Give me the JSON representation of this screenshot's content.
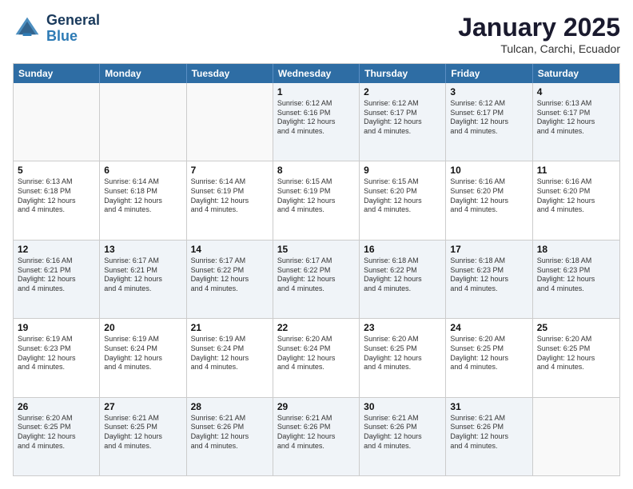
{
  "header": {
    "logo_line1": "General",
    "logo_line2": "Blue",
    "month": "January 2025",
    "location": "Tulcan, Carchi, Ecuador"
  },
  "weekdays": [
    "Sunday",
    "Monday",
    "Tuesday",
    "Wednesday",
    "Thursday",
    "Friday",
    "Saturday"
  ],
  "rows": [
    [
      {
        "day": "",
        "info": ""
      },
      {
        "day": "",
        "info": ""
      },
      {
        "day": "",
        "info": ""
      },
      {
        "day": "1",
        "info": "Sunrise: 6:12 AM\nSunset: 6:16 PM\nDaylight: 12 hours\nand 4 minutes."
      },
      {
        "day": "2",
        "info": "Sunrise: 6:12 AM\nSunset: 6:17 PM\nDaylight: 12 hours\nand 4 minutes."
      },
      {
        "day": "3",
        "info": "Sunrise: 6:12 AM\nSunset: 6:17 PM\nDaylight: 12 hours\nand 4 minutes."
      },
      {
        "day": "4",
        "info": "Sunrise: 6:13 AM\nSunset: 6:17 PM\nDaylight: 12 hours\nand 4 minutes."
      }
    ],
    [
      {
        "day": "5",
        "info": "Sunrise: 6:13 AM\nSunset: 6:18 PM\nDaylight: 12 hours\nand 4 minutes."
      },
      {
        "day": "6",
        "info": "Sunrise: 6:14 AM\nSunset: 6:18 PM\nDaylight: 12 hours\nand 4 minutes."
      },
      {
        "day": "7",
        "info": "Sunrise: 6:14 AM\nSunset: 6:19 PM\nDaylight: 12 hours\nand 4 minutes."
      },
      {
        "day": "8",
        "info": "Sunrise: 6:15 AM\nSunset: 6:19 PM\nDaylight: 12 hours\nand 4 minutes."
      },
      {
        "day": "9",
        "info": "Sunrise: 6:15 AM\nSunset: 6:20 PM\nDaylight: 12 hours\nand 4 minutes."
      },
      {
        "day": "10",
        "info": "Sunrise: 6:16 AM\nSunset: 6:20 PM\nDaylight: 12 hours\nand 4 minutes."
      },
      {
        "day": "11",
        "info": "Sunrise: 6:16 AM\nSunset: 6:20 PM\nDaylight: 12 hours\nand 4 minutes."
      }
    ],
    [
      {
        "day": "12",
        "info": "Sunrise: 6:16 AM\nSunset: 6:21 PM\nDaylight: 12 hours\nand 4 minutes."
      },
      {
        "day": "13",
        "info": "Sunrise: 6:17 AM\nSunset: 6:21 PM\nDaylight: 12 hours\nand 4 minutes."
      },
      {
        "day": "14",
        "info": "Sunrise: 6:17 AM\nSunset: 6:22 PM\nDaylight: 12 hours\nand 4 minutes."
      },
      {
        "day": "15",
        "info": "Sunrise: 6:17 AM\nSunset: 6:22 PM\nDaylight: 12 hours\nand 4 minutes."
      },
      {
        "day": "16",
        "info": "Sunrise: 6:18 AM\nSunset: 6:22 PM\nDaylight: 12 hours\nand 4 minutes."
      },
      {
        "day": "17",
        "info": "Sunrise: 6:18 AM\nSunset: 6:23 PM\nDaylight: 12 hours\nand 4 minutes."
      },
      {
        "day": "18",
        "info": "Sunrise: 6:18 AM\nSunset: 6:23 PM\nDaylight: 12 hours\nand 4 minutes."
      }
    ],
    [
      {
        "day": "19",
        "info": "Sunrise: 6:19 AM\nSunset: 6:23 PM\nDaylight: 12 hours\nand 4 minutes."
      },
      {
        "day": "20",
        "info": "Sunrise: 6:19 AM\nSunset: 6:24 PM\nDaylight: 12 hours\nand 4 minutes."
      },
      {
        "day": "21",
        "info": "Sunrise: 6:19 AM\nSunset: 6:24 PM\nDaylight: 12 hours\nand 4 minutes."
      },
      {
        "day": "22",
        "info": "Sunrise: 6:20 AM\nSunset: 6:24 PM\nDaylight: 12 hours\nand 4 minutes."
      },
      {
        "day": "23",
        "info": "Sunrise: 6:20 AM\nSunset: 6:25 PM\nDaylight: 12 hours\nand 4 minutes."
      },
      {
        "day": "24",
        "info": "Sunrise: 6:20 AM\nSunset: 6:25 PM\nDaylight: 12 hours\nand 4 minutes."
      },
      {
        "day": "25",
        "info": "Sunrise: 6:20 AM\nSunset: 6:25 PM\nDaylight: 12 hours\nand 4 minutes."
      }
    ],
    [
      {
        "day": "26",
        "info": "Sunrise: 6:20 AM\nSunset: 6:25 PM\nDaylight: 12 hours\nand 4 minutes."
      },
      {
        "day": "27",
        "info": "Sunrise: 6:21 AM\nSunset: 6:25 PM\nDaylight: 12 hours\nand 4 minutes."
      },
      {
        "day": "28",
        "info": "Sunrise: 6:21 AM\nSunset: 6:26 PM\nDaylight: 12 hours\nand 4 minutes."
      },
      {
        "day": "29",
        "info": "Sunrise: 6:21 AM\nSunset: 6:26 PM\nDaylight: 12 hours\nand 4 minutes."
      },
      {
        "day": "30",
        "info": "Sunrise: 6:21 AM\nSunset: 6:26 PM\nDaylight: 12 hours\nand 4 minutes."
      },
      {
        "day": "31",
        "info": "Sunrise: 6:21 AM\nSunset: 6:26 PM\nDaylight: 12 hours\nand 4 minutes."
      },
      {
        "day": "",
        "info": ""
      }
    ]
  ],
  "shaded_rows": [
    0,
    2,
    4
  ],
  "shaded_cols": [
    0,
    6
  ]
}
